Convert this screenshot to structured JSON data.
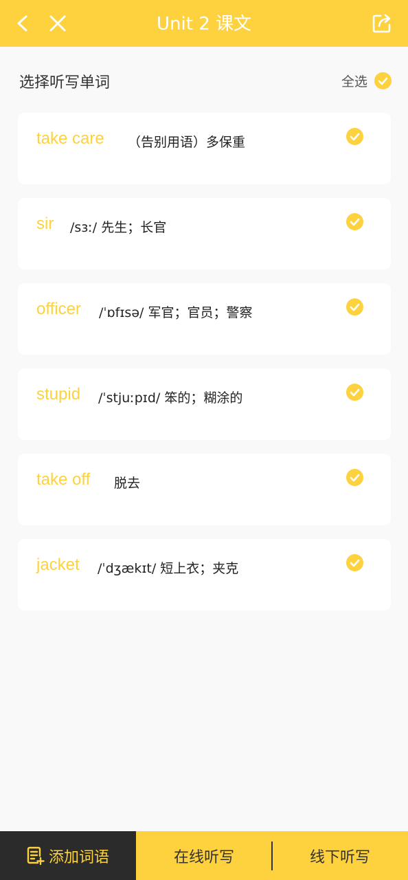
{
  "header": {
    "title": "Unit 2 课文"
  },
  "section": {
    "label": "选择听写单词",
    "select_all": "全选"
  },
  "words": [
    {
      "word": "take care",
      "meaning": "（告别用语）多保重"
    },
    {
      "word": "sir",
      "meaning": "/sɜː/ 先生；长官"
    },
    {
      "word": "officer",
      "meaning": "/ˈɒfɪsə/  军官；官员；警察"
    },
    {
      "word": "stupid",
      "meaning": "/ˈstjuːpɪd/ 笨的；糊涂的"
    },
    {
      "word": "take off",
      "meaning": "脱去"
    },
    {
      "word": "jacket",
      "meaning": "/ˈdʒækɪt/ 短上衣；夹克"
    }
  ],
  "bottom": {
    "add_label": "添加词语",
    "online_label": "在线听写",
    "offline_label": "线下听写"
  },
  "colors": {
    "accent": "#fdd23e",
    "dark": "#2b2b2b"
  },
  "icons": {
    "back": "chevron-left-icon",
    "close": "close-icon",
    "share": "share-icon",
    "check": "check-circle-icon",
    "add": "add-note-icon"
  }
}
